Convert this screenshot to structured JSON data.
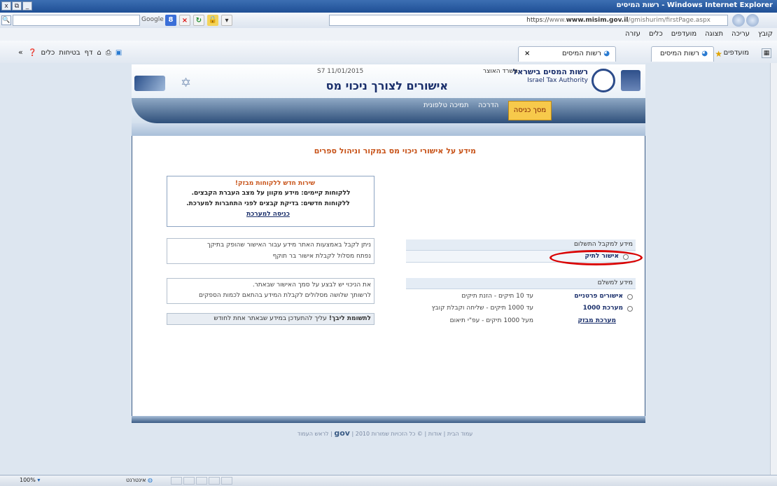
{
  "window": {
    "title": "Windows Internet Explorer - רשות המיסים",
    "controls": [
      "x",
      "⧉",
      "_"
    ]
  },
  "address": {
    "search_engine": "Google",
    "url_prefix": "https://",
    "url_host": "www.misim.gov.il",
    "url_path": "/gmishurim/firstPage.aspx"
  },
  "menu": [
    "קובץ",
    "עריכה",
    "תצוגה",
    "מועדפים",
    "כלים",
    "עזרה"
  ],
  "favorites": {
    "label": "מועדפים",
    "fav_tab": "רשות המיסים",
    "active_tab": "רשות המיסים",
    "close": "×"
  },
  "commandbar": [
    "כלים",
    "בטיחות",
    "דף",
    "▾"
  ],
  "header": {
    "date": "S7 11/01/2015",
    "authority_he": "רשות המסים בישראל",
    "ministry": "משרד האוצר",
    "authority_en": "Israel Tax Authority",
    "title": "אישורים לצורך ניכוי מס"
  },
  "nav": {
    "entry": "מסך כניסה",
    "guide": "הדרכה",
    "phone_support": "תמיכה טלפונית"
  },
  "main": {
    "heading": "מידע על אישורי ניכוי מס במקור וניהול ספרים",
    "promo": {
      "title": "שירות חדש ללקוחות מבזק!",
      "line1": "ללקוחות קיימים: מידע מקוון על מצב העברת הקבצים.",
      "line2": "ללקוחות חדשים: בדיקת קבצים לפני התחברות למערכת.",
      "link": "כניסה למערכת"
    },
    "payee": {
      "header": "מידע למקבל התשלום",
      "option": "אישור לתיק",
      "info_line1": "ניתן לקבל באמצעות האתר מידע עבור האישור שהופק בתיקך",
      "info_line2": "נפתח מסלול לקבלת אישור בר תוקף"
    },
    "payer": {
      "header": "מידע למשלם",
      "rows": [
        {
          "label": "אישורים פרטניים",
          "desc": "עד 10 תיקים - הזנת תיקים"
        },
        {
          "label": "מערכת 1000",
          "desc": "עד 1000 תיקים - שליחה וקבלת קובץ"
        },
        {
          "label": "מערכת מבזק",
          "desc": "מעל 1000 תיקים - עפ\"י תיאום"
        }
      ],
      "info_line1": "את הניכוי יש לבצע על סמך האישור שבאתר.",
      "info_line2": "לרשותך שלושה מסלולים לקבלת המידע בהתאם לכמות הספקים"
    },
    "notice_bold": "לתשומת ליבך!",
    "notice_text": "עליך להתעדכן במידע שבאתר אחת לחודש"
  },
  "footer": {
    "home": "עמוד הבית",
    "about": "אודות",
    "rights": "© כל הזכויות שמורות 2010",
    "gov": "gov",
    "top": "לראש העמוד"
  },
  "status": {
    "zone": "אינטרנט",
    "zoom": "100%"
  },
  "colors": {
    "accent_orange": "#c8541a",
    "nav_dark": "#2e4f7a",
    "highlight_red": "#d90000"
  }
}
